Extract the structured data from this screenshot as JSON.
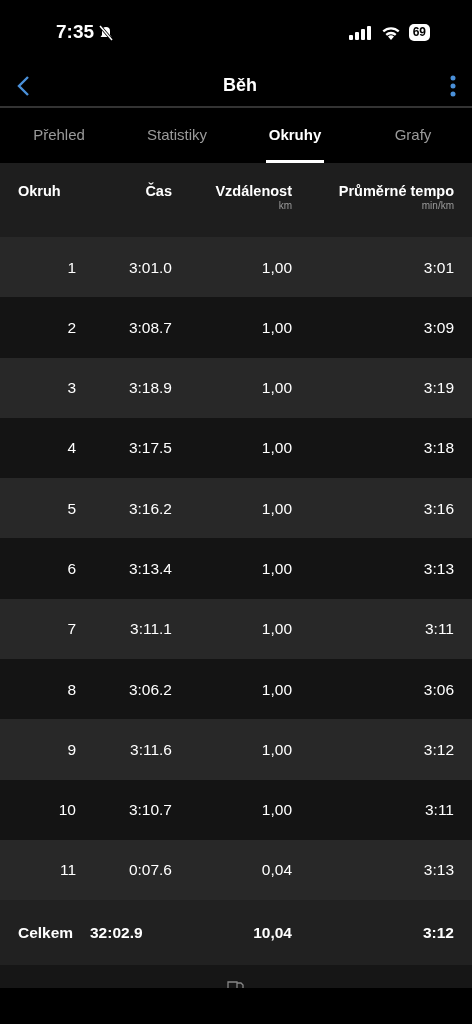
{
  "status_bar": {
    "time": "7:35",
    "battery": "69"
  },
  "nav": {
    "title": "Běh"
  },
  "tabs": [
    {
      "label": "Přehled",
      "selected": false
    },
    {
      "label": "Statistiky",
      "selected": false
    },
    {
      "label": "Okruhy",
      "selected": true
    },
    {
      "label": "Grafy",
      "selected": false
    }
  ],
  "table": {
    "columns": [
      {
        "label": "Okruh"
      },
      {
        "label": "Čas"
      },
      {
        "label": "Vzdálenost",
        "unit": "km"
      },
      {
        "label": "Průměrné tempo",
        "unit": "min/km"
      }
    ],
    "rows": [
      [
        "1",
        "3:01.0",
        "1,00",
        "3:01"
      ],
      [
        "2",
        "3:08.7",
        "1,00",
        "3:09"
      ],
      [
        "3",
        "3:18.9",
        "1,00",
        "3:19"
      ],
      [
        "4",
        "3:17.5",
        "1,00",
        "3:18"
      ],
      [
        "5",
        "3:16.2",
        "1,00",
        "3:16"
      ],
      [
        "6",
        "3:13.4",
        "1,00",
        "3:13"
      ],
      [
        "7",
        "3:11.1",
        "1,00",
        "3:11"
      ],
      [
        "8",
        "3:06.2",
        "1,00",
        "3:06"
      ],
      [
        "9",
        "3:11.6",
        "1,00",
        "3:12"
      ],
      [
        "10",
        "3:10.7",
        "1,00",
        "3:11"
      ],
      [
        "11",
        "0:07.6",
        "0,04",
        "3:13"
      ]
    ],
    "total": [
      "Celkem",
      "32:02.9",
      "10,04",
      "3:12"
    ]
  }
}
